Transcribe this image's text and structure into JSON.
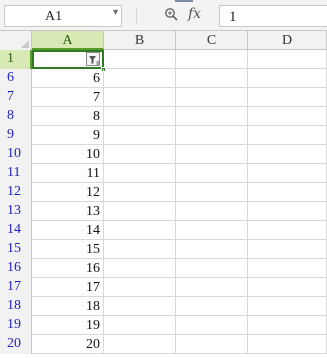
{
  "formula_bar": {
    "name_box": "A1",
    "formula_value": "1",
    "icons": [
      "zoom-icon",
      "fx-icon",
      "dropdown-arrow-icon"
    ]
  },
  "sheet": {
    "columns": [
      "A",
      "B",
      "C",
      "D"
    ],
    "active_column": "A",
    "rows": [
      {
        "num": "1",
        "a": ""
      },
      {
        "num": "6",
        "a": "6"
      },
      {
        "num": "7",
        "a": "7"
      },
      {
        "num": "8",
        "a": "8"
      },
      {
        "num": "9",
        "a": "9"
      },
      {
        "num": "10",
        "a": "10"
      },
      {
        "num": "11",
        "a": "11"
      },
      {
        "num": "12",
        "a": "12"
      },
      {
        "num": "13",
        "a": "13"
      },
      {
        "num": "14",
        "a": "14"
      },
      {
        "num": "15",
        "a": "15"
      },
      {
        "num": "16",
        "a": "16"
      },
      {
        "num": "17",
        "a": "17"
      },
      {
        "num": "18",
        "a": "18"
      },
      {
        "num": "19",
        "a": "19"
      },
      {
        "num": "20",
        "a": "20"
      }
    ],
    "colors": {
      "selection": "#2f7a24",
      "active_header": "#d9e9b5",
      "row_number": "#2222bb"
    }
  }
}
